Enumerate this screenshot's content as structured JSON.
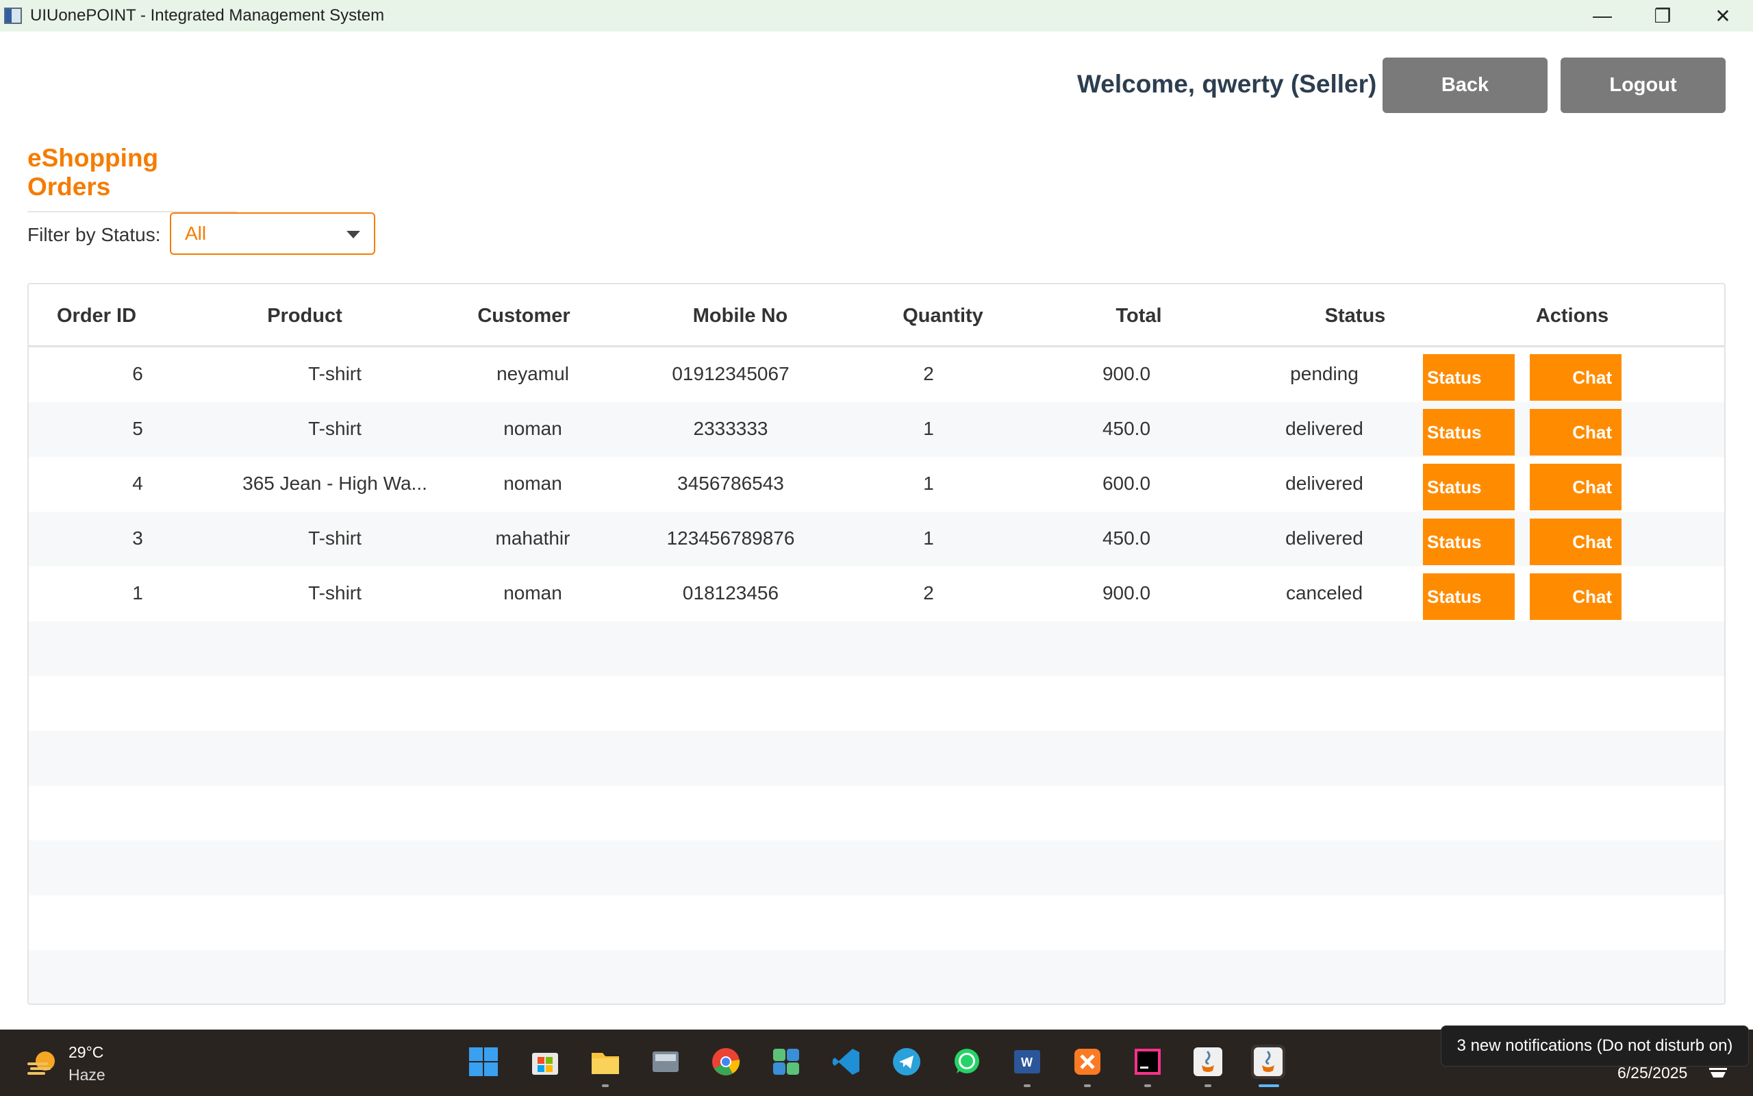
{
  "window": {
    "title": "UIUonePOINT - Integrated Management System",
    "minimize_glyph": "—",
    "maximize_glyph": "❐",
    "close_glyph": "✕"
  },
  "header": {
    "welcome": "Welcome, qwerty (Seller)",
    "back_label": "Back",
    "logout_label": "Logout"
  },
  "page": {
    "title": "eShopping Orders"
  },
  "filter": {
    "label": "Filter by Status:",
    "selected": "All"
  },
  "table": {
    "columns": [
      "Order ID",
      "Product",
      "Customer",
      "Mobile No",
      "Quantity",
      "Total",
      "Status",
      "Actions"
    ],
    "rows": [
      {
        "order_id": "6",
        "product": "T-shirt",
        "customer": "neyamul",
        "mobile": "01912345067",
        "quantity": "2",
        "total": "900.0",
        "status": "pending"
      },
      {
        "order_id": "5",
        "product": "T-shirt",
        "customer": "noman",
        "mobile": "2333333",
        "quantity": "1",
        "total": "450.0",
        "status": "delivered"
      },
      {
        "order_id": "4",
        "product": "365 Jean - High Wa...",
        "customer": "noman",
        "mobile": "3456786543",
        "quantity": "1",
        "total": "600.0",
        "status": "delivered"
      },
      {
        "order_id": "3",
        "product": "T-shirt",
        "customer": "mahathir",
        "mobile": "123456789876",
        "quantity": "1",
        "total": "450.0",
        "status": "delivered"
      },
      {
        "order_id": "1",
        "product": "T-shirt",
        "customer": "noman",
        "mobile": "018123456",
        "quantity": "2",
        "total": "900.0",
        "status": "canceled"
      }
    ],
    "status_button_label": "Status",
    "chat_button_label": "Chat"
  },
  "taskbar": {
    "weather_temp": "29°C",
    "weather_desc": "Haze",
    "notification": "3 new notifications (Do not disturb on)",
    "date": "6/25/2025",
    "apps": [
      "start-icon",
      "store-icon",
      "file-explorer-icon",
      "keyboard-app-icon",
      "chrome-icon",
      "office-app-icon",
      "vscode-icon",
      "telegram-icon",
      "whatsapp-icon",
      "word-icon",
      "xampp-icon",
      "intellij-icon",
      "java-icon",
      "java-app-active-icon"
    ]
  },
  "colors": {
    "accent": "#f57c00",
    "action_button": "#ff8c00",
    "header_button": "#7a7a7a",
    "titlebar": "#e8f4e8",
    "taskbar": "#2a2420"
  }
}
